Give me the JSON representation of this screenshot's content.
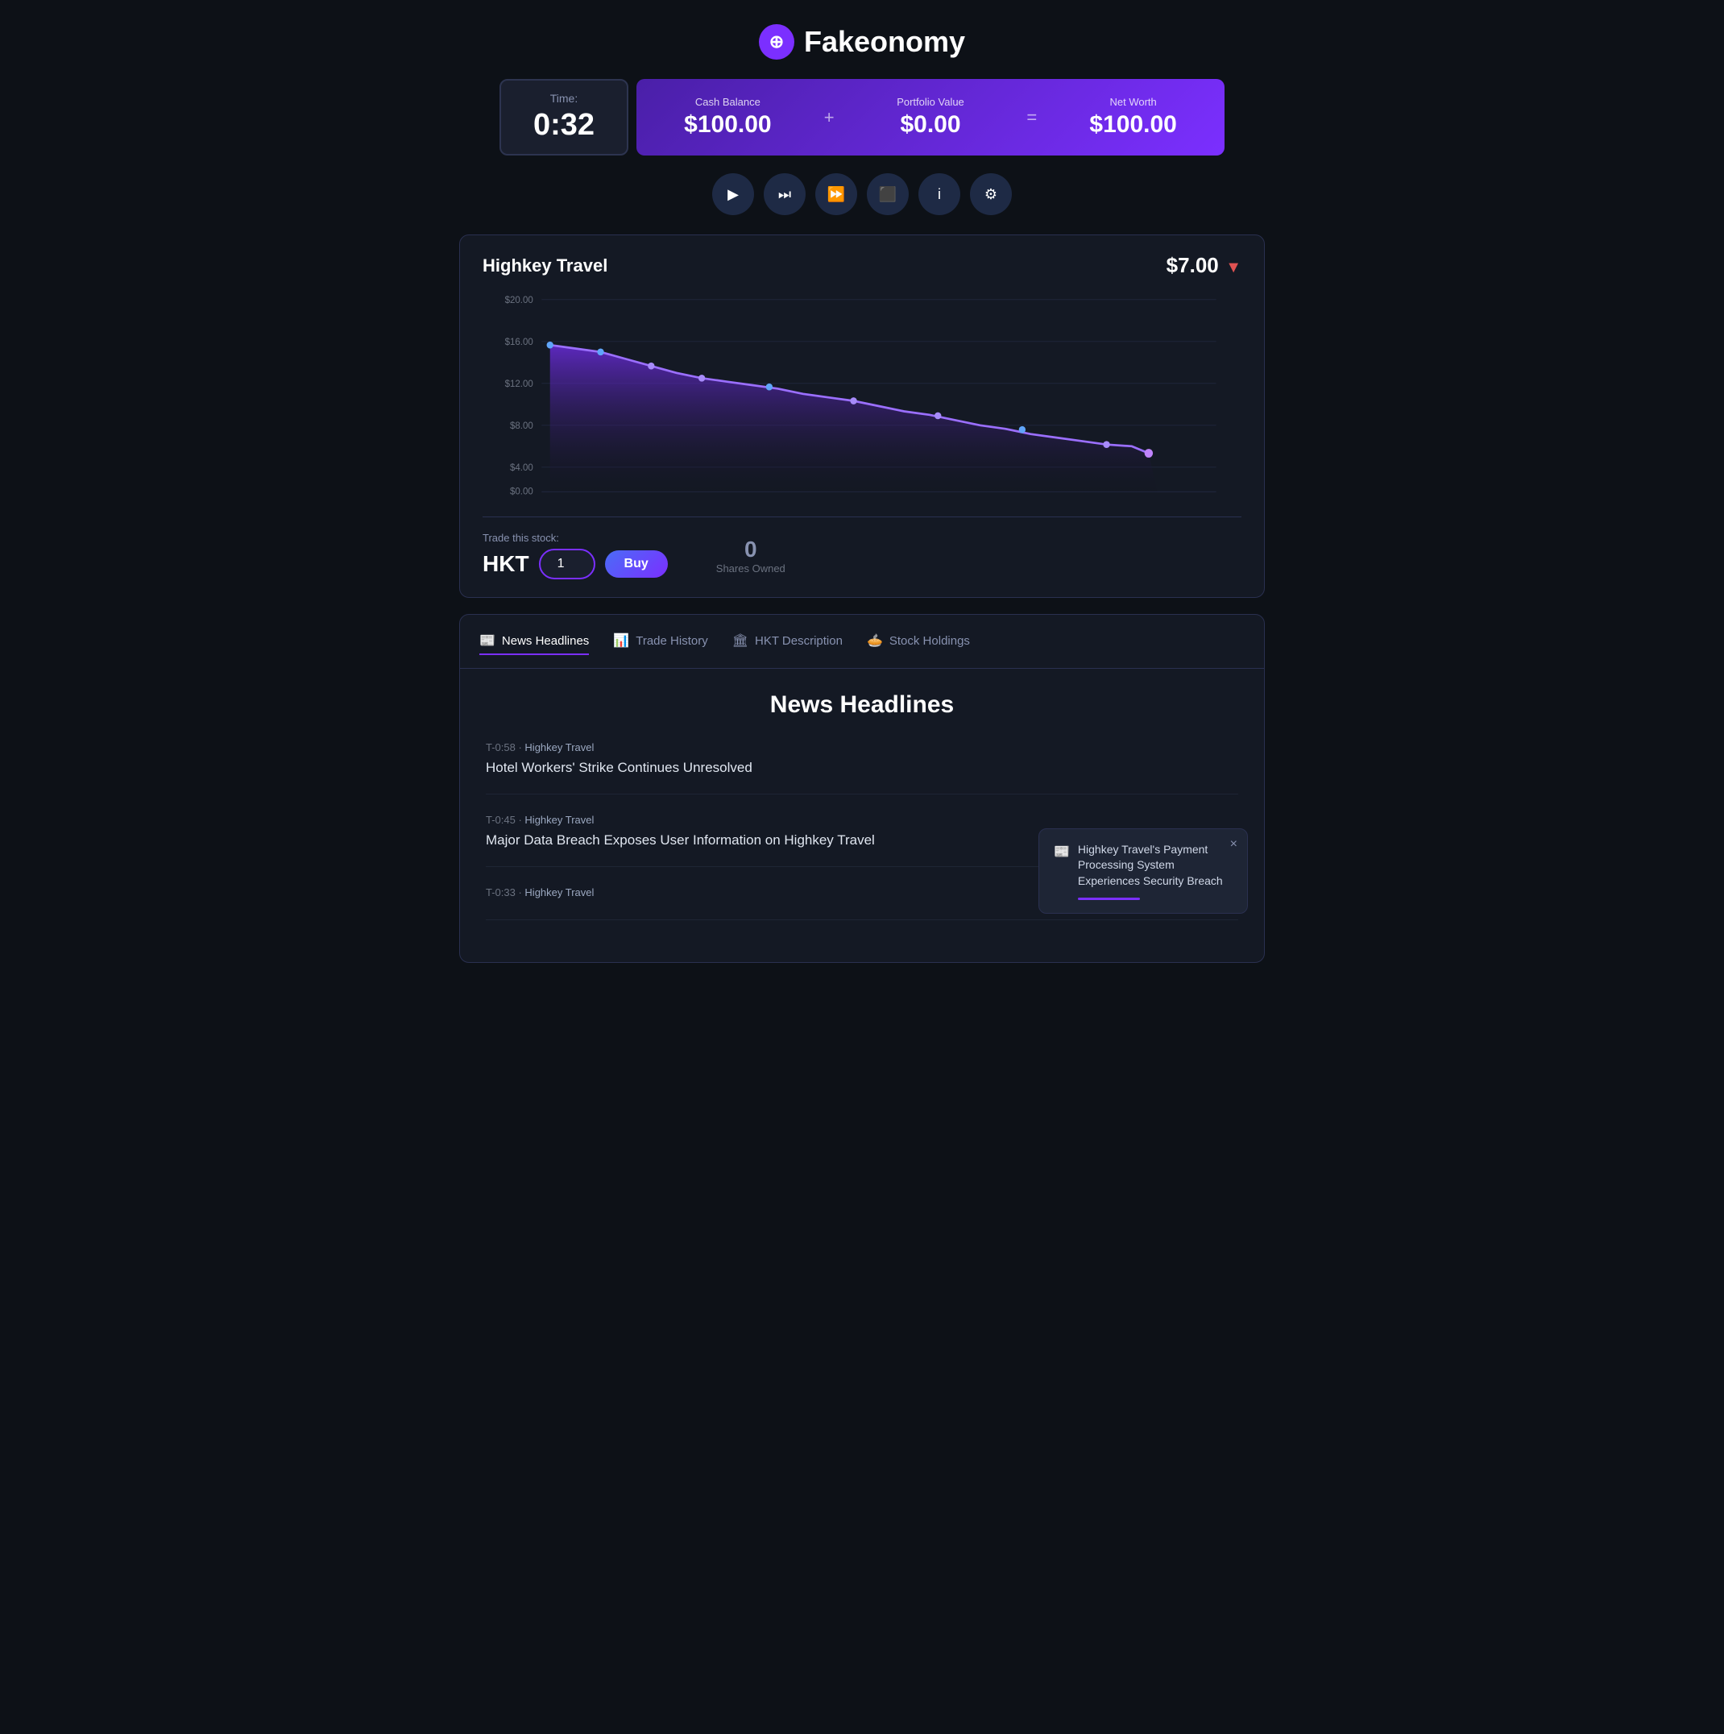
{
  "app": {
    "title": "Fakeonomy",
    "logo_symbol": "Ø"
  },
  "stats": {
    "time_label": "Time:",
    "time_value": "0:32",
    "cash_label": "Cash Balance",
    "cash_value": "$100.00",
    "portfolio_label": "Portfolio Value",
    "portfolio_value": "$0.00",
    "networth_label": "Net Worth",
    "networth_value": "$100.00",
    "plus_symbol": "+",
    "equals_symbol": "="
  },
  "controls": {
    "play": "▶",
    "skip": "⏭",
    "fast_forward": "⏩",
    "stop": "⏹",
    "info": "i",
    "settings": "⚙"
  },
  "stock": {
    "name": "Highkey Travel",
    "price": "$7.00",
    "price_direction": "down",
    "ticker": "HKT",
    "trade_label": "Trade this stock:",
    "quantity": "1",
    "buy_label": "Buy",
    "shares_owned": "0",
    "shares_label": "Shares Owned"
  },
  "chart": {
    "y_labels": [
      "$20.00",
      "$16.00",
      "$12.00",
      "$8.00",
      "$4.00",
      "$0.00"
    ],
    "color_fill_start": "#7b2fff",
    "color_fill_end": "#0d1117"
  },
  "tabs": [
    {
      "id": "news",
      "label": "News Headlines",
      "icon": "📰",
      "active": true
    },
    {
      "id": "trade",
      "label": "Trade History",
      "icon": "📊",
      "active": false
    },
    {
      "id": "desc",
      "label": "HKT Description",
      "icon": "🏛",
      "active": false
    },
    {
      "id": "holdings",
      "label": "Stock Holdings",
      "icon": "🥧",
      "active": false
    }
  ],
  "news": {
    "title": "News Headlines",
    "items": [
      {
        "time": "T-0:58",
        "company": "Highkey Travel",
        "headline": "Hotel Workers' Strike Continues Unresolved"
      },
      {
        "time": "T-0:45",
        "company": "Highkey Travel",
        "headline": "Major Data Breach Exposes User Information on Highkey Travel"
      },
      {
        "time": "T-0:33",
        "company": "Highkey Travel",
        "headline": ""
      }
    ]
  },
  "toast": {
    "text": "Highkey Travel's Payment Processing System Experiences Security Breach",
    "close_label": "×"
  }
}
